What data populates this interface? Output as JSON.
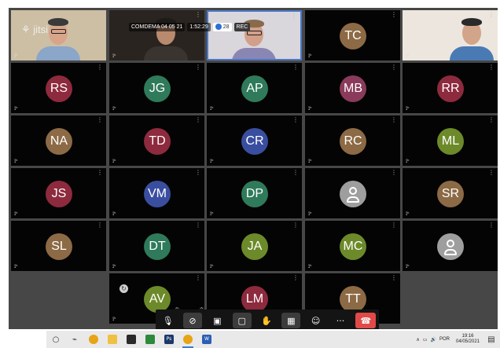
{
  "meeting": {
    "logo": "jitsi",
    "room_name": "COMDEMA 04 05 21",
    "duration": "1:52:29",
    "participant_count": "28",
    "rec_label": "REC",
    "mute_glyph": "⟟ᵏ"
  },
  "tiles": [
    {
      "kind": "video",
      "variant": "man-glasses"
    },
    {
      "kind": "video",
      "variant": "man-dark-room"
    },
    {
      "kind": "video",
      "variant": "woman-glasses",
      "active": true
    },
    {
      "kind": "initials",
      "text": "TC",
      "color": "#8c6a45"
    },
    {
      "kind": "video",
      "variant": "man-light-room"
    },
    {
      "kind": "initials",
      "text": "RS",
      "color": "#8e2a3e"
    },
    {
      "kind": "initials",
      "text": "JG",
      "color": "#2f7a5a"
    },
    {
      "kind": "initials",
      "text": "AP",
      "color": "#2f7a5a"
    },
    {
      "kind": "initials",
      "text": "MB",
      "color": "#8a3a5a"
    },
    {
      "kind": "initials",
      "text": "RR",
      "color": "#8e2a3e"
    },
    {
      "kind": "initials",
      "text": "NA",
      "color": "#8c6a45"
    },
    {
      "kind": "initials",
      "text": "TD",
      "color": "#8e2a3e"
    },
    {
      "kind": "initials",
      "text": "CR",
      "color": "#3a4ea0"
    },
    {
      "kind": "initials",
      "text": "RC",
      "color": "#8c6a45"
    },
    {
      "kind": "initials",
      "text": "ML",
      "color": "#6c8a2a"
    },
    {
      "kind": "initials",
      "text": "JS",
      "color": "#8e2a3e"
    },
    {
      "kind": "initials",
      "text": "VM",
      "color": "#3a4ea0"
    },
    {
      "kind": "initials",
      "text": "DP",
      "color": "#2f7a5a"
    },
    {
      "kind": "person",
      "text": ""
    },
    {
      "kind": "initials",
      "text": "SR",
      "color": "#8c6a45"
    },
    {
      "kind": "initials",
      "text": "SL",
      "color": "#8c6a45"
    },
    {
      "kind": "initials",
      "text": "DT",
      "color": "#2f7a5a"
    },
    {
      "kind": "initials",
      "text": "JA",
      "color": "#6c8a2a"
    },
    {
      "kind": "initials",
      "text": "MC",
      "color": "#6c8a2a"
    },
    {
      "kind": "person",
      "text": ""
    },
    {
      "kind": "initials",
      "text": "AV",
      "color": "#6c8a2a"
    },
    {
      "kind": "initials",
      "text": "LM",
      "color": "#8e2a3e"
    },
    {
      "kind": "initials",
      "text": "TT",
      "color": "#8c6a45"
    }
  ],
  "toolbar": [
    {
      "name": "microphone-muted-icon",
      "glyph": "🎙",
      "style": "plain",
      "caret": true
    },
    {
      "name": "camera-off-icon",
      "glyph": "⊘",
      "style": "dim",
      "caret": true
    },
    {
      "name": "screen-share-icon",
      "glyph": "▣",
      "style": "plain",
      "caret": false
    },
    {
      "name": "chat-icon",
      "glyph": "▢",
      "style": "dim",
      "caret": false
    },
    {
      "name": "raise-hand-icon",
      "glyph": "✋",
      "style": "plain",
      "caret": false
    },
    {
      "name": "tile-view-icon",
      "glyph": "▦",
      "style": "dim",
      "caret": false
    },
    {
      "name": "participants-icon",
      "glyph": "☺",
      "style": "plain",
      "caret": false
    },
    {
      "name": "more-options-icon",
      "glyph": "···",
      "style": "plain",
      "caret": false
    },
    {
      "name": "hang-up-icon",
      "glyph": "☎",
      "style": "hang",
      "caret": false
    }
  ],
  "taskbar": {
    "apps": [
      {
        "name": "cortana-search-icon",
        "glyph": "○",
        "color": "",
        "label": ""
      },
      {
        "name": "task-view-icon",
        "glyph": "⌁",
        "color": "",
        "label": ""
      },
      {
        "name": "chrome-icon",
        "glyph": "",
        "color": "#e6a417",
        "label": ""
      },
      {
        "name": "file-explorer-icon",
        "glyph": "",
        "color": "#f0c040",
        "label": ""
      },
      {
        "name": "media-app-icon",
        "glyph": "",
        "color": "#2a2a2a",
        "label": ""
      },
      {
        "name": "xbox-icon",
        "glyph": "",
        "color": "#2c8a3a",
        "label": ""
      },
      {
        "name": "photoshop-icon",
        "glyph": "",
        "color": "#1b3a6a",
        "label": "Ps"
      },
      {
        "name": "chrome-active-icon",
        "glyph": "",
        "color": "#e6a417",
        "label": "",
        "active": true
      },
      {
        "name": "word-icon",
        "glyph": "",
        "color": "#2b5fb4",
        "label": "W"
      }
    ],
    "tray": {
      "chevron": "∧",
      "language": "POR",
      "time": "19:16",
      "date": "04/05/2021"
    }
  }
}
